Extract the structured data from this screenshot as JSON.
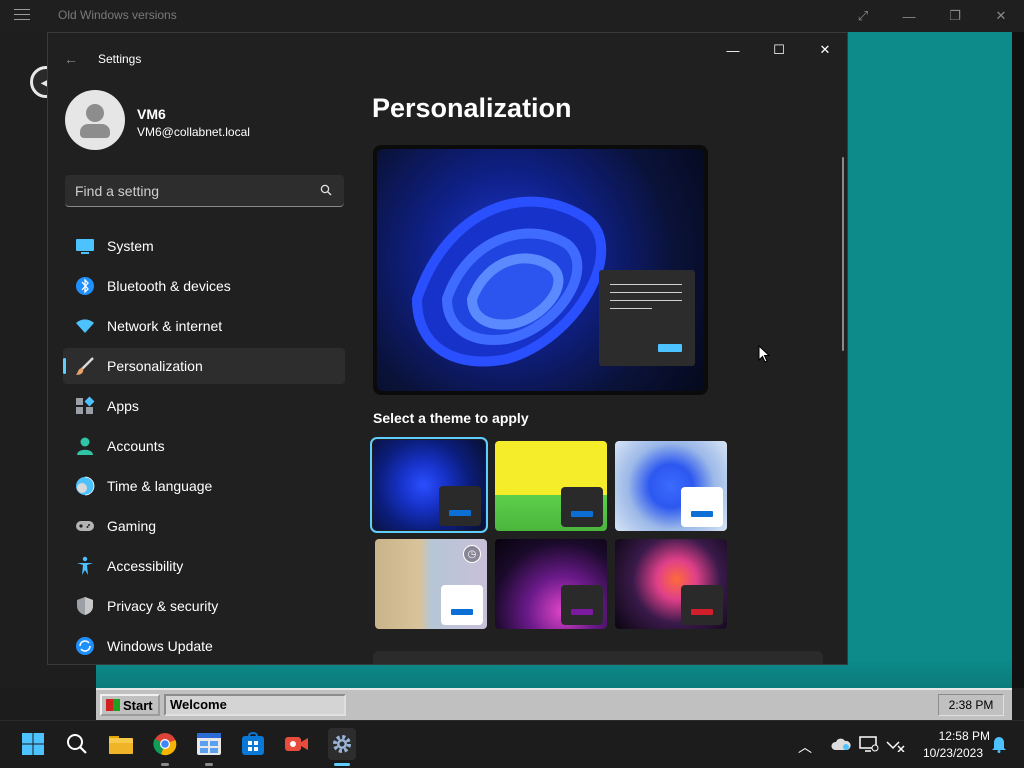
{
  "host": {
    "title": "Old Windows versions",
    "buttons": [
      "⤢",
      "—",
      "❐",
      "✕"
    ]
  },
  "settings_window": {
    "title": "Settings",
    "user": {
      "name": "VM6",
      "email": "VM6@collabnet.local"
    },
    "search": {
      "placeholder": "Find a setting"
    },
    "nav": [
      {
        "label": "System",
        "icon": "system-icon",
        "color": "#4cc2ff"
      },
      {
        "label": "Bluetooth & devices",
        "icon": "bluetooth-icon",
        "color": "#1e90ff"
      },
      {
        "label": "Network & internet",
        "icon": "wifi-icon",
        "color": "#4cc2ff"
      },
      {
        "label": "Personalization",
        "icon": "brush-icon",
        "color": "#e6a36b",
        "active": true
      },
      {
        "label": "Apps",
        "icon": "apps-icon",
        "color": "#9aa0a6"
      },
      {
        "label": "Accounts",
        "icon": "accounts-icon",
        "color": "#2fc5a5"
      },
      {
        "label": "Time & language",
        "icon": "globe-icon",
        "color": "#4cc2ff"
      },
      {
        "label": "Gaming",
        "icon": "gamepad-icon",
        "color": "#b4b4b4"
      },
      {
        "label": "Accessibility",
        "icon": "accessibility-icon",
        "color": "#4cc2ff"
      },
      {
        "label": "Privacy & security",
        "icon": "shield-icon",
        "color": "#9aa0a6"
      },
      {
        "label": "Windows Update",
        "icon": "update-icon",
        "color": "#1e90ff"
      }
    ],
    "page_heading": "Personalization",
    "theme_heading": "Select a theme to apply",
    "themes": [
      {
        "name": "windows-dark",
        "accent": "#0b6fd6",
        "mini_bg": "#2a2a2a",
        "selected": true
      },
      {
        "name": "windows-95-classic",
        "accent": "#0b6fd6",
        "mini_bg": "#2a2a2a"
      },
      {
        "name": "windows-light",
        "accent": "#0b6fd6",
        "mini_bg": "#ffffff"
      },
      {
        "name": "glow",
        "accent": "#0b6fd6",
        "mini_bg": "#ffffff",
        "badge": true
      },
      {
        "name": "captured-motion",
        "accent": "#7a1a9e",
        "mini_bg": "#2a2a2a"
      },
      {
        "name": "flow",
        "accent": "#d21f2b",
        "mini_bg": "#2a2a2a"
      }
    ]
  },
  "old_taskbar": {
    "start_label": "Start",
    "task_label": "Welcome",
    "clock": "2:38 PM"
  },
  "taskbar": {
    "apps": [
      "start-icon",
      "search-icon",
      "file-explorer-icon",
      "chrome-icon",
      "widgets-icon",
      "store-icon",
      "camera-icon",
      "settings-app-icon"
    ],
    "time": "12:58 PM",
    "date": "10/23/2023"
  }
}
